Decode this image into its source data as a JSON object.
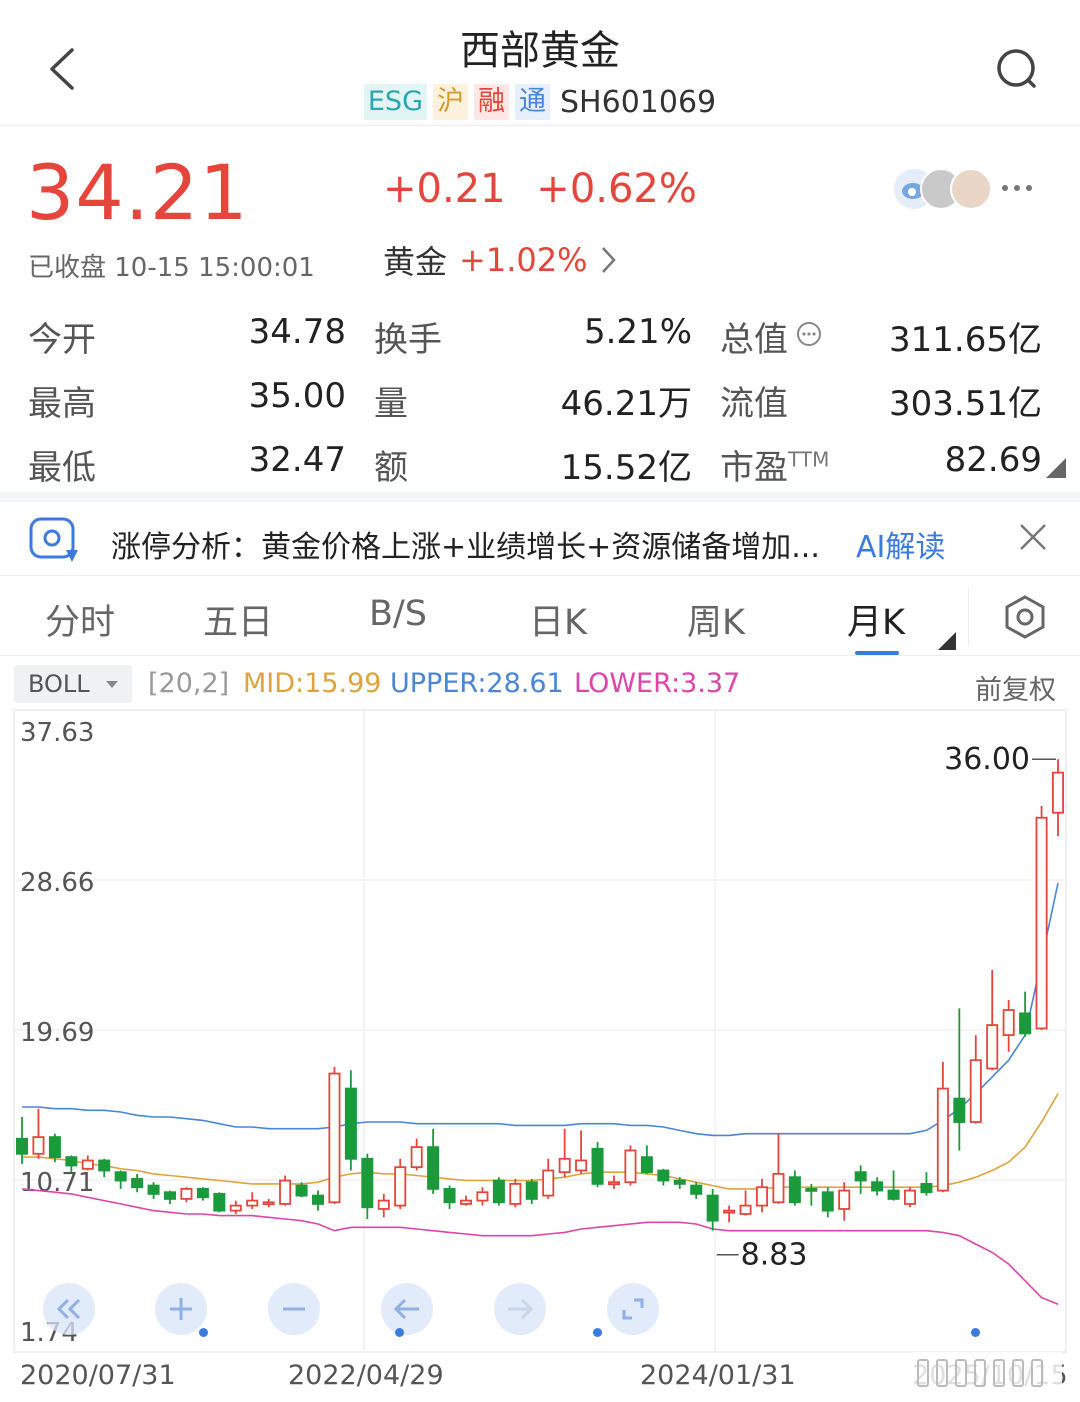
{
  "header": {
    "title": "西部黄金",
    "tags": [
      "ESG",
      "沪",
      "融",
      "通"
    ],
    "code": "SH601069"
  },
  "quote": {
    "price": "34.21",
    "change": "+0.21",
    "change_pct": "+0.62%",
    "status": "已收盘 10-15 15:00:01",
    "sector_name": "黄金",
    "sector_change": "+1.02%"
  },
  "stats": {
    "open_label": "今开",
    "open_value": "34.78",
    "high_label": "最高",
    "high_value": "35.00",
    "low_label": "最低",
    "low_value": "32.47",
    "turnover_label": "换手",
    "turnover_value": "5.21%",
    "volume_label": "量",
    "volume_value": "46.21万",
    "amount_label": "额",
    "amount_value": "15.52亿",
    "mcap_label": "总值",
    "mcap_value": "311.65亿",
    "float_label": "流值",
    "float_value": "303.51亿",
    "pe_label": "市盈",
    "pe_sup": "TTM",
    "pe_value": "82.69"
  },
  "ai_bar": {
    "text": "涨停分析：黄金价格上涨+业绩增长+资源储备增加...",
    "link": "AI解读"
  },
  "tabs": [
    "分时",
    "五日",
    "B/S",
    "日K",
    "周K",
    "月K"
  ],
  "active_tab": "月K",
  "indicator": {
    "name": "BOLL",
    "params": "[20,2]",
    "mid": "MID:15.99",
    "upper": "UPPER:28.61",
    "lower": "LOWER:3.37",
    "adjust": "前复权"
  },
  "chart_data": {
    "type": "candlestick",
    "y_ticks": [
      "37.63",
      "28.66",
      "19.69",
      "10.71",
      "1.74"
    ],
    "ylim": [
      1.74,
      37.63
    ],
    "x_ticks": [
      "2020/07/31",
      "2022/04/29",
      "2024/01/31"
    ],
    "last_date_label": "2025/10/15",
    "max_label": "36.00",
    "min_label": "8.83",
    "candles": [
      [
        13.3,
        12.4,
        14.6,
        11.8
      ],
      [
        12.4,
        13.4,
        15.1,
        12.1
      ],
      [
        13.4,
        12.2,
        13.6,
        11.9
      ],
      [
        12.2,
        11.7,
        12.3,
        11.3
      ],
      [
        11.5,
        12.0,
        12.3,
        11.4
      ],
      [
        12.0,
        11.4,
        12.1,
        11.0
      ],
      [
        11.3,
        10.8,
        11.4,
        10.3
      ],
      [
        10.9,
        10.4,
        11.2,
        10.1
      ],
      [
        10.5,
        10.0,
        10.7,
        9.7
      ],
      [
        10.1,
        9.7,
        10.2,
        9.4
      ],
      [
        9.7,
        10.3,
        10.4,
        9.5
      ],
      [
        10.3,
        9.8,
        10.4,
        9.6
      ],
      [
        10.0,
        9.0,
        10.1,
        8.9
      ],
      [
        9.0,
        9.3,
        9.6,
        8.8
      ],
      [
        9.3,
        9.6,
        10.1,
        9.1
      ],
      [
        9.5,
        9.5,
        9.7,
        9.2
      ],
      [
        9.4,
        10.8,
        11.1,
        9.3
      ],
      [
        10.5,
        9.9,
        10.7,
        9.8
      ],
      [
        9.9,
        9.4,
        10.2,
        9.0
      ],
      [
        9.5,
        17.2,
        17.6,
        9.4
      ],
      [
        16.3,
        12.1,
        17.4,
        11.4
      ],
      [
        12.1,
        9.2,
        12.4,
        8.5
      ],
      [
        9.1,
        9.6,
        10.0,
        8.6
      ],
      [
        9.3,
        11.6,
        12.1,
        9.1
      ],
      [
        11.6,
        12.8,
        13.3,
        11.4
      ],
      [
        12.8,
        10.3,
        13.9,
        10.0
      ],
      [
        10.3,
        9.5,
        10.5,
        9.1
      ],
      [
        9.4,
        9.6,
        9.9,
        9.3
      ],
      [
        9.6,
        10.1,
        10.4,
        9.3
      ],
      [
        10.8,
        9.5,
        11.0,
        9.3
      ],
      [
        9.4,
        10.6,
        10.9,
        9.2
      ],
      [
        10.7,
        9.7,
        10.9,
        9.4
      ],
      [
        9.9,
        11.4,
        12.1,
        9.7
      ],
      [
        11.3,
        12.1,
        13.9,
        11.0
      ],
      [
        11.4,
        12.0,
        13.8,
        11.2
      ],
      [
        12.7,
        10.6,
        13.1,
        10.4
      ],
      [
        10.6,
        10.7,
        11.1,
        10.3
      ],
      [
        10.7,
        12.6,
        12.9,
        10.5
      ],
      [
        12.2,
        11.3,
        12.9,
        11.2
      ],
      [
        11.4,
        10.8,
        11.5,
        10.5
      ],
      [
        10.8,
        10.6,
        11.0,
        10.3
      ],
      [
        10.5,
        10.0,
        10.7,
        9.7
      ],
      [
        9.9,
        8.4,
        10.3,
        7.8
      ],
      [
        8.9,
        9.0,
        9.3,
        8.3
      ],
      [
        8.8,
        9.3,
        10.2,
        8.7
      ],
      [
        9.3,
        10.4,
        10.9,
        8.9
      ],
      [
        9.5,
        11.2,
        13.6,
        9.4
      ],
      [
        11.0,
        9.5,
        11.4,
        9.3
      ],
      [
        10.3,
        10.2,
        10.6,
        9.3
      ],
      [
        10.1,
        9.0,
        10.4,
        8.6
      ],
      [
        9.1,
        10.2,
        10.7,
        8.4
      ],
      [
        11.3,
        10.8,
        11.7,
        10.0
      ],
      [
        10.7,
        10.2,
        11.0,
        9.9
      ],
      [
        10.2,
        9.7,
        11.4,
        9.6
      ],
      [
        9.4,
        10.2,
        10.4,
        9.2
      ],
      [
        10.6,
        10.1,
        11.3,
        9.9
      ],
      [
        10.2,
        16.3,
        17.9,
        10.1
      ],
      [
        15.7,
        14.3,
        21.1,
        12.6
      ],
      [
        14.3,
        18.0,
        19.5,
        14.2
      ],
      [
        17.5,
        20.1,
        23.4,
        17.4
      ],
      [
        19.5,
        21.0,
        21.6,
        18.5
      ],
      [
        20.8,
        19.6,
        22.1,
        19.4
      ],
      [
        19.9,
        32.5,
        33.2,
        19.8
      ],
      [
        32.8,
        35.2,
        36.0,
        31.4
      ]
    ],
    "boll_upper": [
      15.2,
      15.2,
      15.1,
      15.1,
      15.0,
      15.0,
      14.9,
      14.7,
      14.6,
      14.6,
      14.5,
      14.4,
      14.2,
      14.0,
      14.0,
      13.9,
      13.9,
      13.9,
      13.9,
      14.0,
      14.2,
      14.3,
      14.3,
      14.3,
      14.2,
      14.2,
      14.2,
      14.2,
      14.2,
      14.2,
      14.1,
      14.1,
      14.1,
      14.1,
      14.2,
      14.2,
      14.2,
      14.1,
      14.1,
      14.0,
      13.8,
      13.6,
      13.5,
      13.5,
      13.6,
      13.6,
      13.6,
      13.6,
      13.6,
      13.6,
      13.6,
      13.6,
      13.6,
      13.6,
      13.6,
      13.8,
      14.4,
      15.1,
      16.0,
      17.0,
      18.0,
      19.5,
      24.0,
      28.6
    ],
    "boll_mid": [
      12.2,
      12.2,
      12.1,
      12.0,
      11.8,
      11.7,
      11.5,
      11.4,
      11.2,
      11.1,
      11.0,
      10.9,
      10.8,
      10.7,
      10.6,
      10.6,
      10.6,
      10.6,
      10.7,
      11.0,
      11.2,
      11.3,
      11.2,
      11.2,
      11.1,
      11.0,
      10.9,
      10.8,
      10.8,
      10.8,
      10.8,
      10.8,
      10.9,
      11.0,
      11.2,
      11.3,
      11.3,
      11.3,
      11.2,
      11.1,
      10.9,
      10.7,
      10.5,
      10.3,
      10.3,
      10.3,
      10.4,
      10.4,
      10.4,
      10.4,
      10.4,
      10.4,
      10.4,
      10.4,
      10.4,
      10.4,
      10.5,
      10.7,
      11.0,
      11.4,
      11.9,
      12.8,
      14.3,
      16.0
    ],
    "boll_lower": [
      10.3,
      10.2,
      10.1,
      10.0,
      9.8,
      9.6,
      9.4,
      9.2,
      9.0,
      8.9,
      8.8,
      8.8,
      8.7,
      8.7,
      8.7,
      8.6,
      8.5,
      8.4,
      8.2,
      7.8,
      8.0,
      8.0,
      8.0,
      8.0,
      7.9,
      7.8,
      7.7,
      7.6,
      7.5,
      7.5,
      7.5,
      7.5,
      7.6,
      7.7,
      7.9,
      8.0,
      8.1,
      8.2,
      8.3,
      8.3,
      8.3,
      8.2,
      7.9,
      7.8,
      7.8,
      7.8,
      7.8,
      7.8,
      7.8,
      7.8,
      7.8,
      7.8,
      7.8,
      7.8,
      7.8,
      7.8,
      7.7,
      7.5,
      7.0,
      6.5,
      5.8,
      4.8,
      3.8,
      3.4
    ]
  },
  "controls": [
    "fast-back",
    "zoom-in",
    "zoom-out",
    "move-left",
    "move-right",
    "fullscreen"
  ]
}
